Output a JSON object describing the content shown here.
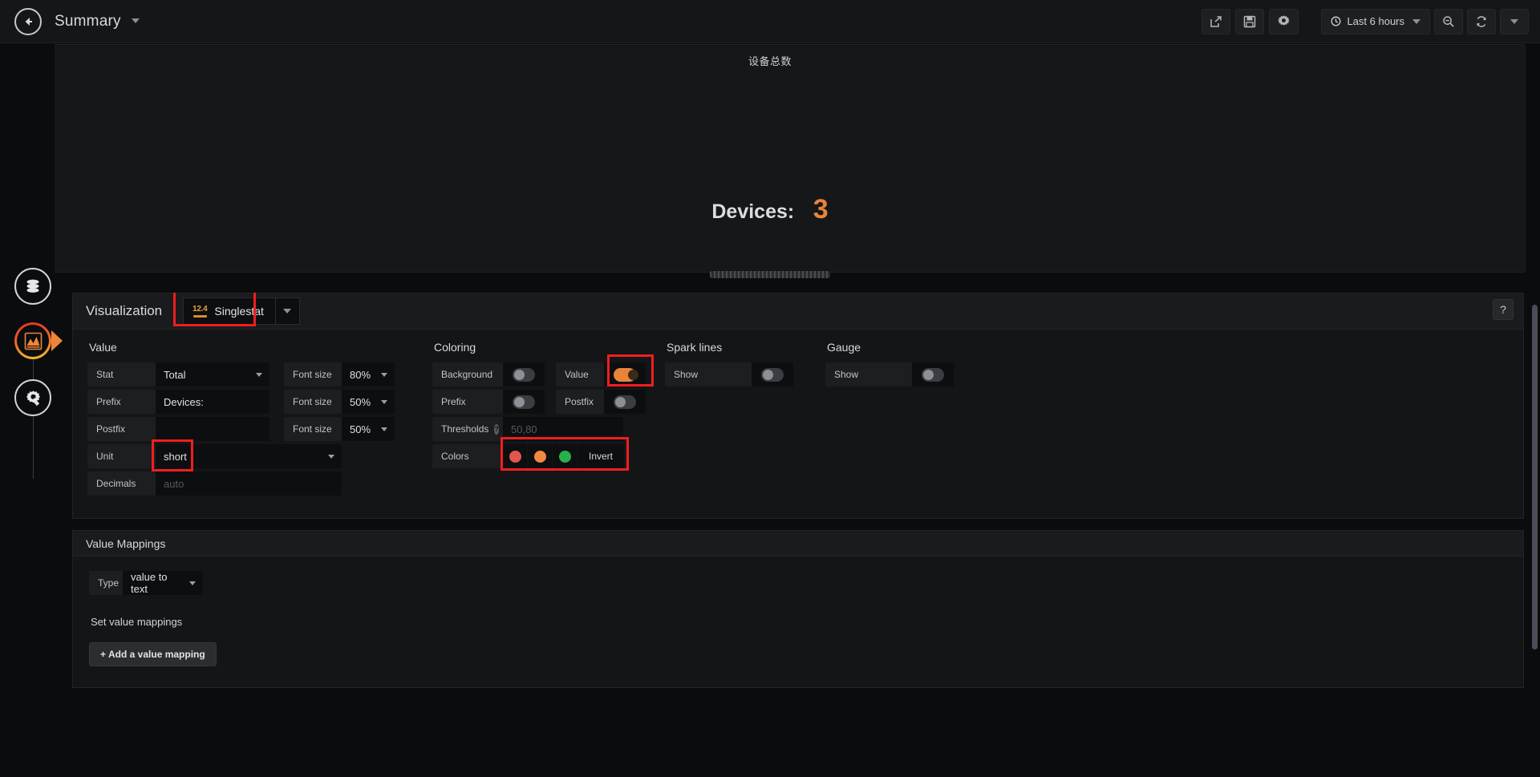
{
  "navbar": {
    "back_icon": "back-arrow-icon",
    "dashboard_title": "Summary",
    "share_icon": "share-icon",
    "save_icon": "save-icon",
    "settings_icon": "gear-icon",
    "time_range": "Last 6 hours",
    "clock_icon": "clock-icon",
    "zoom_out_icon": "zoom-out-search-icon",
    "refresh_icon": "refresh-icon",
    "refresh_caret": "chevron-down-icon"
  },
  "rail": {
    "datasource_icon": "database-icon",
    "visualization_icon": "chart-icon",
    "settings_icon": "wrench-gear-icon"
  },
  "preview": {
    "panel_title": "设备总数",
    "prefix": "Devices:",
    "value": "3",
    "value_color": "#e8843a"
  },
  "visualization": {
    "label": "Visualization",
    "type_icon_text": "12.4",
    "type_name": "Singlestat",
    "caret_icon": "chevron-down-icon",
    "help_label": "?"
  },
  "value_section": {
    "title": "Value",
    "stat_label": "Stat",
    "stat_value": "Total",
    "stat_font_size_label": "Font size",
    "stat_font_size_value": "80%",
    "prefix_label": "Prefix",
    "prefix_value": "Devices:",
    "prefix_font_size_label": "Font size",
    "prefix_font_size_value": "50%",
    "postfix_label": "Postfix",
    "postfix_value": "",
    "postfix_font_size_label": "Font size",
    "postfix_font_size_value": "50%",
    "unit_label": "Unit",
    "unit_value": "short",
    "decimals_label": "Decimals",
    "decimals_placeholder": "auto"
  },
  "coloring_section": {
    "title": "Coloring",
    "background_label": "Background",
    "background_on": false,
    "value_label": "Value",
    "value_on": true,
    "prefix_label": "Prefix",
    "prefix_on": false,
    "postfix_label": "Postfix",
    "postfix_on": false,
    "thresholds_label": "Thresholds",
    "thresholds_help": "?",
    "thresholds_placeholder": "50,80",
    "colors_label": "Colors",
    "color_1": "#e2574c",
    "color_2": "#ef8a3f",
    "color_3": "#28b14a",
    "invert_label": "Invert"
  },
  "sparklines_section": {
    "title": "Spark lines",
    "show_label": "Show",
    "show_on": false
  },
  "gauge_section": {
    "title": "Gauge",
    "show_label": "Show",
    "show_on": false
  },
  "value_mappings": {
    "title": "Value Mappings",
    "type_label": "Type",
    "type_value": "value to text",
    "type_caret": "chevron-down-icon",
    "subtitle": "Set value mappings",
    "add_button": "Add a value mapping",
    "add_icon": "plus-icon"
  },
  "annotations": {
    "accent_red": "#f01e1e"
  }
}
